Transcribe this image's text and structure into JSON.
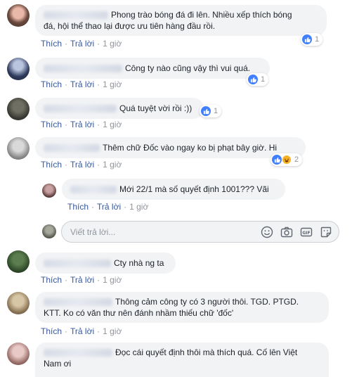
{
  "comments": [
    {
      "text_line1": "Phong trào bóng đá đi lên. Nhiều xếp thích bóng",
      "text_line2": "đá, hội thể thao lại được ưu tiên hàng đầu rồi.",
      "like": "Thích",
      "reply": "Trả lời",
      "time": "1 giờ",
      "reaction_count": "1"
    },
    {
      "text": "Công ty nào cũng vậy thì vui quá.",
      "like": "Thích",
      "reply": "Trả lời",
      "time": "1 giờ",
      "reaction_count": "1"
    },
    {
      "text": "Quá tuyệt vời rồi :))",
      "like": "Thích",
      "reply": "Trả lời",
      "time": "1 giờ",
      "reaction_count": "1"
    },
    {
      "text": "Thêm chữ Đốc vào ngay ko bị phạt bây giờ. Hi",
      "like": "Thích",
      "reply": "Trả lời",
      "time": "1 giờ",
      "reaction_count": "2"
    },
    {
      "text": "Cty nhà ng ta",
      "like": "Thích",
      "reply": "Trả lời",
      "time": "1 giờ"
    },
    {
      "text_line1": "Thông cảm công ty có 3 người thôi. TGD. PTGD.",
      "text_line2": "KTT. Ko có văn thư nên đánh nhầm thiếu chữ 'đốc'",
      "like": "Thích",
      "reply": "Trả lời",
      "time": "1 giờ"
    },
    {
      "text_line1": "Đọc cái quyết định thôi mà thích quá. Cố lên Việt",
      "text_line2": "Nam ơi"
    }
  ],
  "nested_reply": {
    "text": "Mới 22/1 mà số quyết định 1001??? Vãi",
    "like": "Thích",
    "reply": "Trả lời",
    "time": "1 giờ"
  },
  "reply_box": {
    "placeholder": "Viết trả lời..."
  },
  "colors": {
    "link": "#385898",
    "bubble": "#f2f3f5",
    "muted": "#90949c",
    "like_blue": "#4080ff"
  }
}
